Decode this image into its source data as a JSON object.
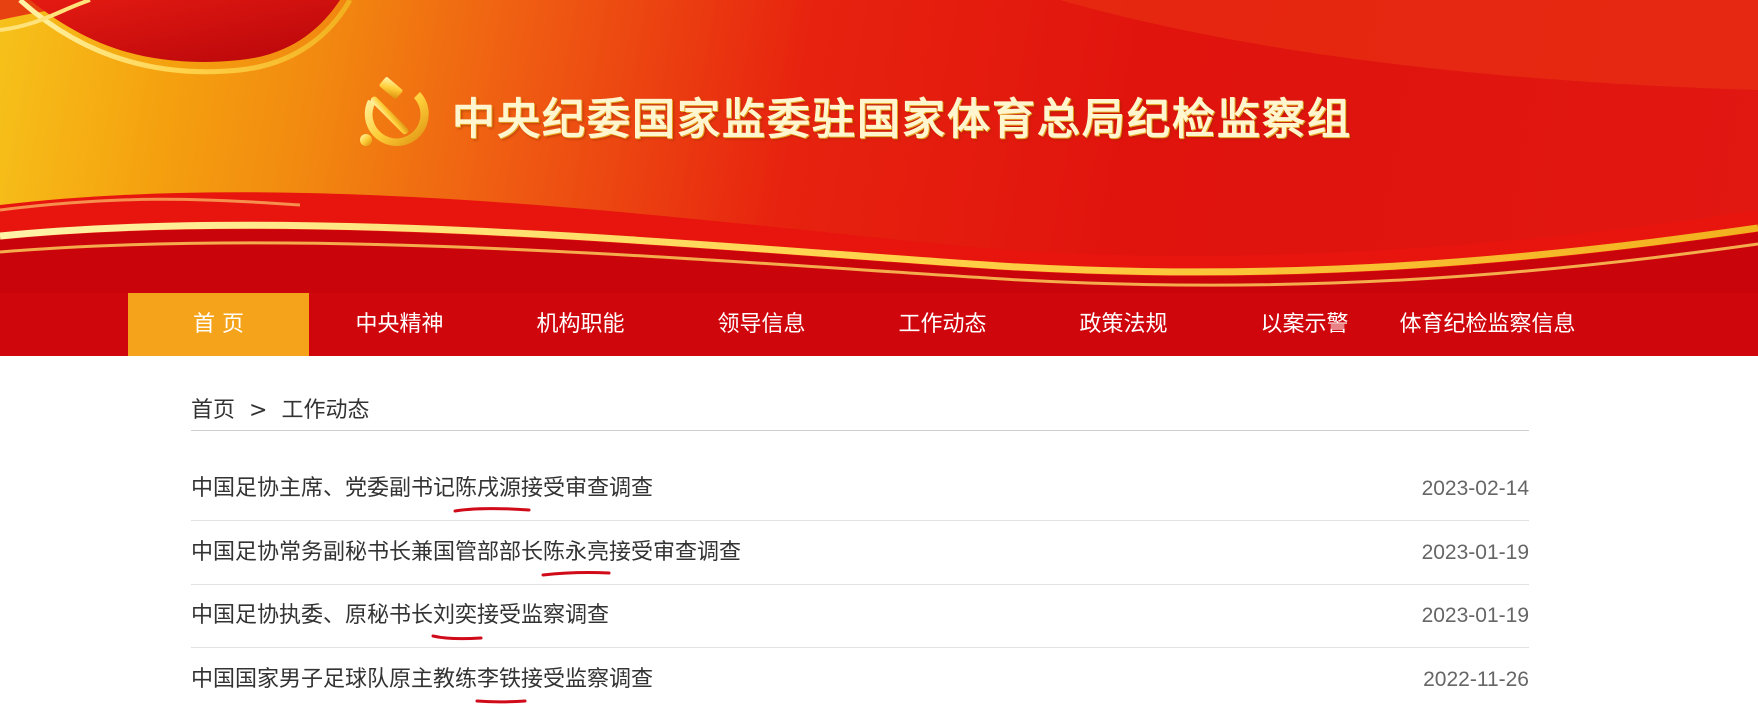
{
  "header": {
    "site_title": "中央纪委国家监委驻国家体育总局纪检监察组",
    "emblem_icon": "hammer-sickle-icon"
  },
  "nav": {
    "items": [
      {
        "label": "首 页",
        "active": true
      },
      {
        "label": "中央精神"
      },
      {
        "label": "机构职能"
      },
      {
        "label": "领导信息"
      },
      {
        "label": "工作动态"
      },
      {
        "label": "政策法规"
      },
      {
        "label": "以案示警"
      },
      {
        "label": "体育纪检监察信息"
      }
    ]
  },
  "breadcrumb": {
    "home": "首页",
    "separator": ">",
    "current": "工作动态"
  },
  "articles": [
    {
      "pre": "中国足协主席、党委副书记",
      "name": "陈戌源",
      "post": "接受审查调查",
      "date": "2023-02-14"
    },
    {
      "pre": "中国足协常务副秘书长兼国管部部长",
      "name": "陈永亮",
      "post": "接受审查调查",
      "date": "2023-01-19"
    },
    {
      "pre": "中国足协执委、原秘书长",
      "name": "刘奕",
      "post": "接受监察调查",
      "date": "2023-01-19"
    },
    {
      "pre": "中国国家男子足球队原主教练",
      "name": "李铁",
      "post": "接受监察调查",
      "date": "2022-11-26"
    }
  ],
  "colors": {
    "nav_bg": "#d0060d",
    "nav_active": "#f5a31a",
    "annotation_underline": "#d10a1a"
  }
}
